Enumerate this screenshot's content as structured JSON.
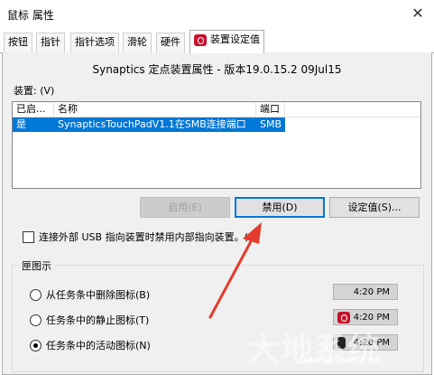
{
  "window": {
    "title": "鼠标 属性",
    "close_glyph": "✕"
  },
  "tabs": [
    {
      "label": "按钮"
    },
    {
      "label": "指针"
    },
    {
      "label": "指针选项"
    },
    {
      "label": "滑轮"
    },
    {
      "label": "硬件"
    },
    {
      "label": "装置设定值",
      "active": true,
      "icon": "synaptics-icon"
    }
  ],
  "panel": {
    "heading": "Synaptics 定点装置属性 - 版本19.0.15.2 09Jul15",
    "devices_label": "装置: (V)",
    "devices_table": {
      "columns": [
        "已启...",
        "名称",
        "端口"
      ],
      "rows": [
        {
          "enabled": "是",
          "name": "SynapticsTouchPadV1.1在SMB连接端口",
          "port": "SMB",
          "selected": true
        }
      ]
    },
    "buttons": {
      "enable": "启用(E)",
      "disable": "禁用(D)",
      "settings": "设定值(S)..."
    },
    "checkbox_label": "连接外部 USB 指向装置时禁用内部指向装置。(U)",
    "checkbox_checked": false,
    "tray_group": {
      "label": "匣图示",
      "options": [
        {
          "label": "从任务条中删除图标(B)",
          "checked": false,
          "time": "4:20 PM",
          "icon": "none"
        },
        {
          "label": "任务条中的静止图标(T)",
          "checked": false,
          "time": "4:20 PM",
          "icon": "synaptics-icon"
        },
        {
          "label": "任务条中的活动图标(N)",
          "checked": true,
          "time": "4:20 PM",
          "icon": "touchpad-active-icon"
        }
      ]
    }
  },
  "annotation": {
    "arrow_color": "#e53b2c"
  },
  "watermark": {
    "text": "大地系统",
    "subtext": "DadiGhost.com"
  },
  "colors": {
    "selection": "#0078d7",
    "focus_border": "#0078d7",
    "brand": "#c8102e"
  }
}
